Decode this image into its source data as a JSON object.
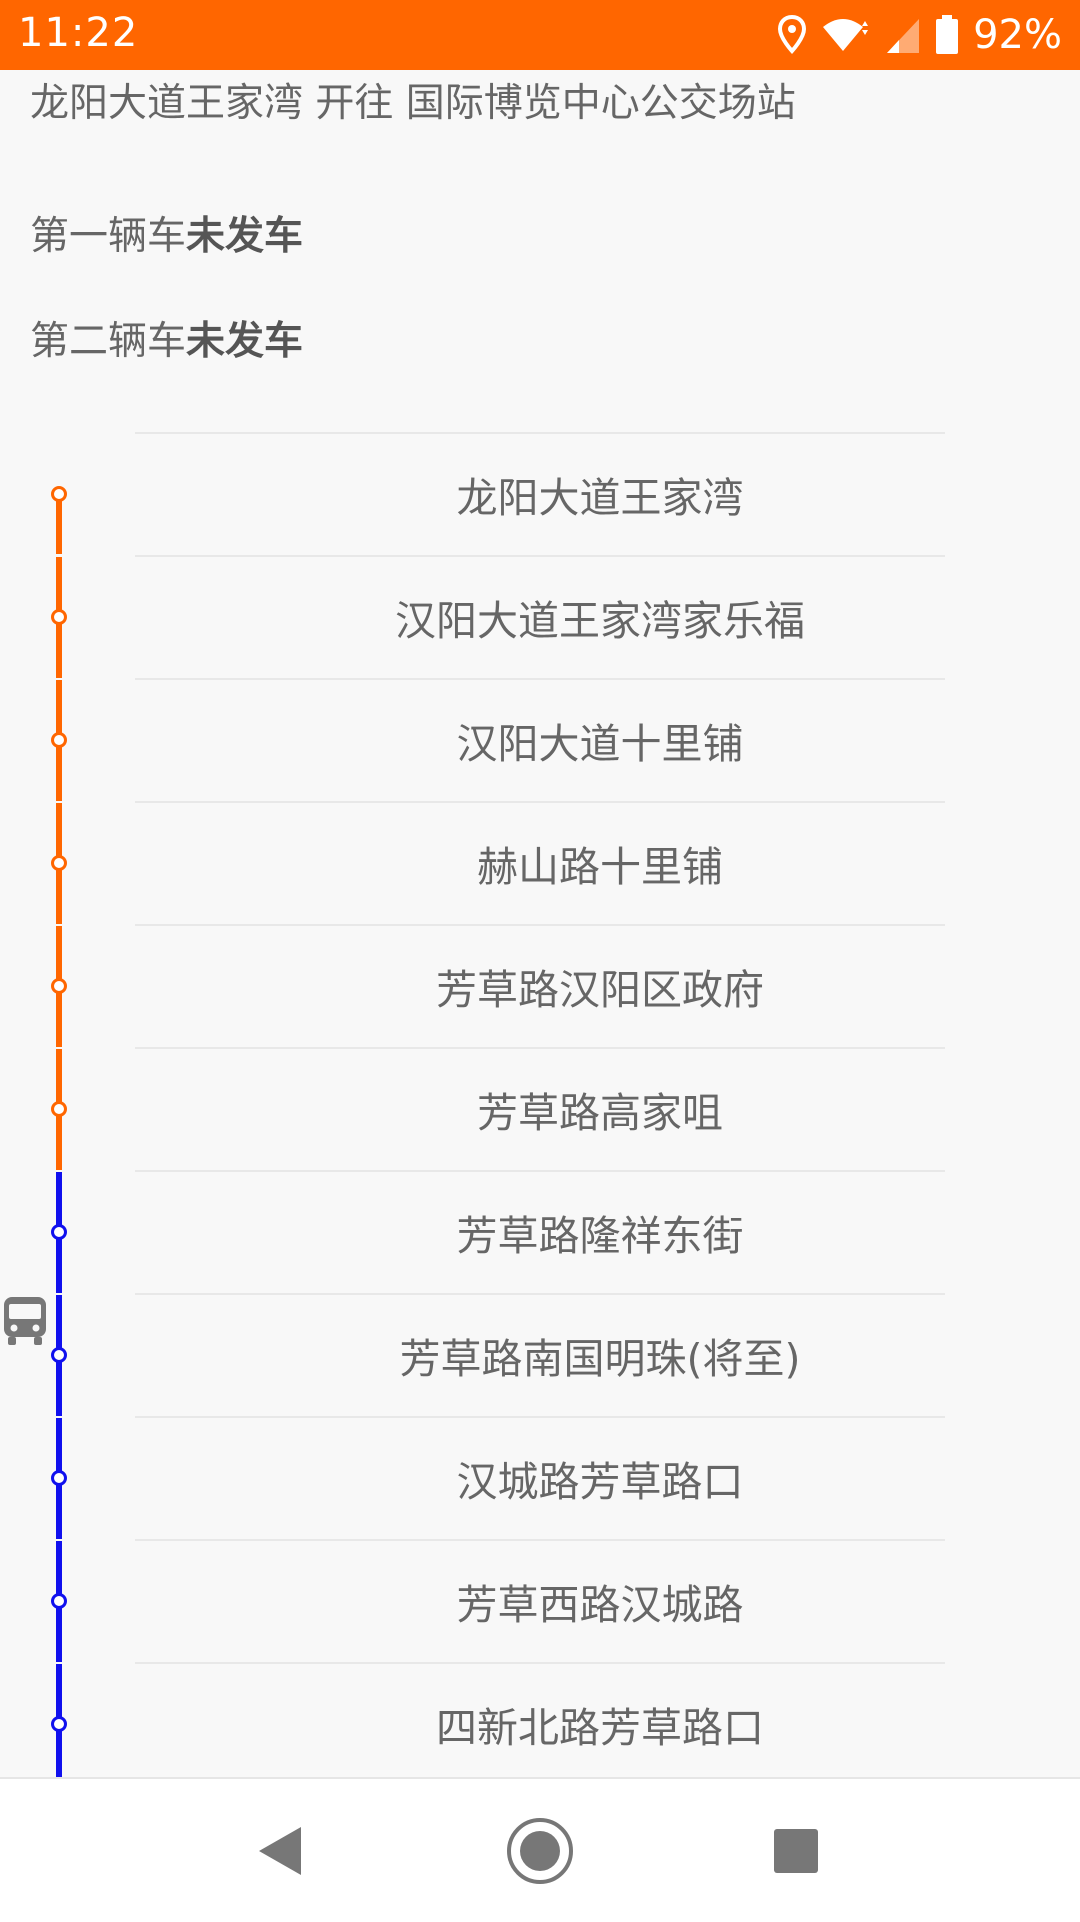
{
  "status_bar": {
    "time": "11:22",
    "battery_percent": "92%",
    "icons": [
      "location-icon",
      "wifi-icon",
      "signal-icon",
      "battery-icon"
    ],
    "color": "#ff6600"
  },
  "route": {
    "direction": "龙阳大道王家湾 开往 国际博览中心公交场站"
  },
  "buses": [
    {
      "label": "第一辆车",
      "status": "未发车"
    },
    {
      "label": "第二辆车",
      "status": "未发车"
    }
  ],
  "stations": [
    {
      "name": "龙阳大道王家湾",
      "line_color": "#ff6600"
    },
    {
      "name": "汉阳大道王家湾家乐福",
      "line_color": "#ff6600"
    },
    {
      "name": "汉阳大道十里铺",
      "line_color": "#ff6600"
    },
    {
      "name": "赫山路十里铺",
      "line_color": "#ff6600"
    },
    {
      "name": "芳草路汉阳区政府",
      "line_color": "#ff6600"
    },
    {
      "name": "芳草路高家咀",
      "line_color": "#ff6600"
    },
    {
      "name": "芳草路隆祥东街",
      "line_color": "#1010ee"
    },
    {
      "name": "芳草路南国明珠(将至)",
      "line_color": "#1010ee",
      "bus_here": true
    },
    {
      "name": "汉城路芳草路口",
      "line_color": "#1010ee"
    },
    {
      "name": "芳草西路汉城路",
      "line_color": "#1010ee"
    },
    {
      "name": "四新北路芳草路口",
      "line_color": "#1010ee"
    }
  ],
  "nav_bar": {
    "buttons": [
      "back-icon",
      "home-icon",
      "recents-icon"
    ]
  }
}
